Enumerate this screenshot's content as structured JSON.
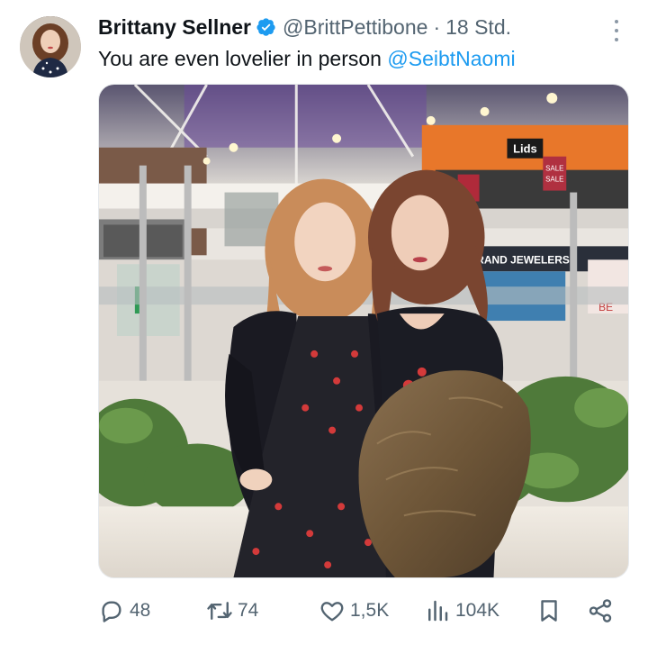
{
  "author": {
    "display_name": "Brittany Sellner",
    "handle": "@BrittPettibone",
    "separator": "·",
    "time": "18 Std.",
    "verified": true,
    "avatar_icon": "profile-photo"
  },
  "tweet": {
    "text": "You are even lovelier in person",
    "mention": "@SeibtNaomi",
    "media_alt": "Two women posing in a shopping mall"
  },
  "photo_signs": {
    "lids": "Lids",
    "grand_jewelers": "GRAND JEWELERS",
    "sale_1": "SALE",
    "sale_2": "SALE",
    "store_left": "BE"
  },
  "actions": {
    "replies": "48",
    "reposts": "74",
    "likes": "1,5K",
    "views": "104K"
  },
  "icons": {
    "reply": "speech-bubble-icon",
    "repost": "repost-arrows-icon",
    "like": "heart-icon",
    "views": "bar-chart-icon",
    "bookmark": "bookmark-icon",
    "share": "share-icon",
    "more": "vertical-ellipsis-icon",
    "verified": "verified-badge-icon"
  },
  "colors": {
    "accent": "#1d9bf0",
    "text": "#0f1419",
    "muted": "#536471"
  }
}
